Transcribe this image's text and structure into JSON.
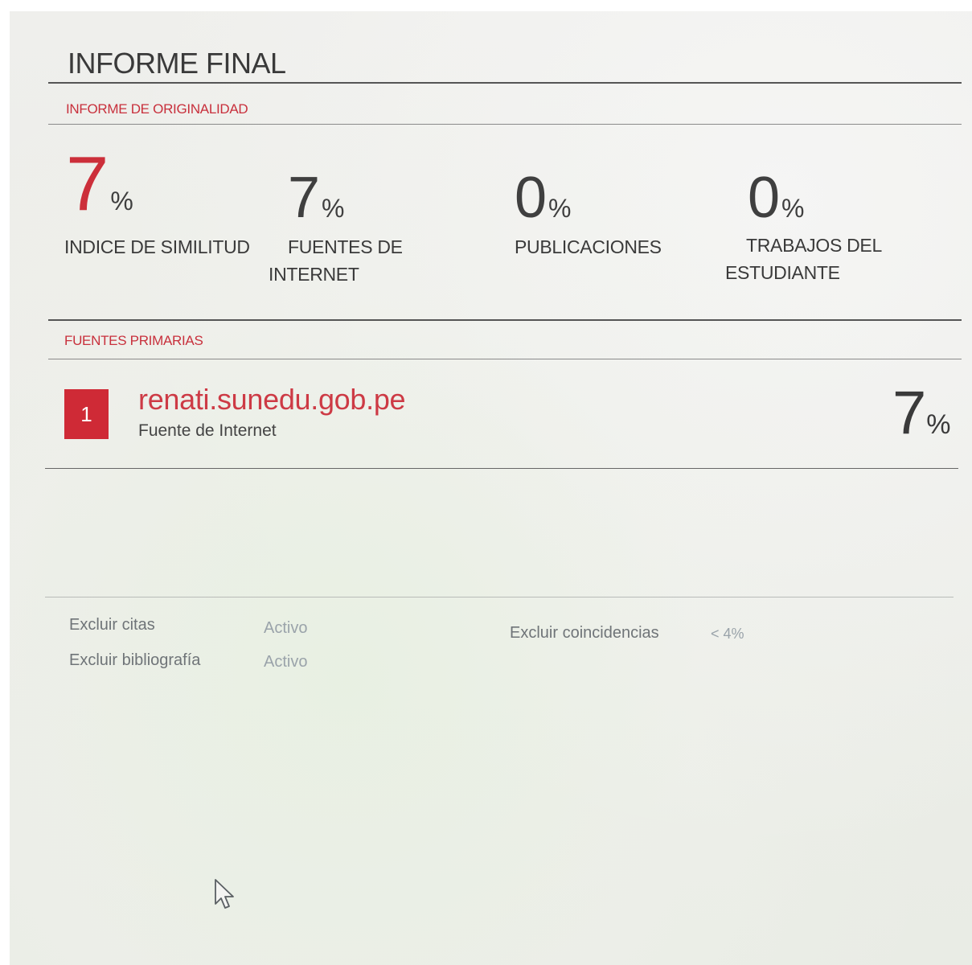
{
  "report": {
    "title": "INFORME FINAL",
    "originality_label": "INFORME DE ORIGINALIDAD",
    "stats": [
      {
        "value": "7",
        "unit": "%",
        "label_lines": [
          "INDICE DE SIMILITUD"
        ]
      },
      {
        "value": "7",
        "unit": "%",
        "label_lines": [
          "FUENTES DE",
          "INTERNET"
        ]
      },
      {
        "value": "0",
        "unit": "%",
        "label_lines": [
          "PUBLICACIONES"
        ]
      },
      {
        "value": "0",
        "unit": "%",
        "label_lines": [
          "TRABAJOS DEL",
          "ESTUDIANTE"
        ]
      }
    ],
    "primary_sources_label": "FUENTES PRIMARIAS",
    "sources": [
      {
        "rank": "1",
        "name": "renati.sunedu.gob.pe",
        "type": "Fuente de Internet",
        "value": "7",
        "unit": "%"
      }
    ],
    "settings": {
      "exclude_quotes": {
        "label": "Excluir citas",
        "value": "Activo"
      },
      "exclude_bibliography": {
        "label": "Excluir bibliografía",
        "value": "Activo"
      },
      "exclude_matches": {
        "label": "Excluir coincidencias",
        "value": "< 4%"
      }
    }
  },
  "colors": {
    "accent": "#cc2f3a",
    "text": "#3a3a3a",
    "muted": "#9aa3aa"
  },
  "icons": {
    "cursor": "mouse-pointer-icon"
  }
}
